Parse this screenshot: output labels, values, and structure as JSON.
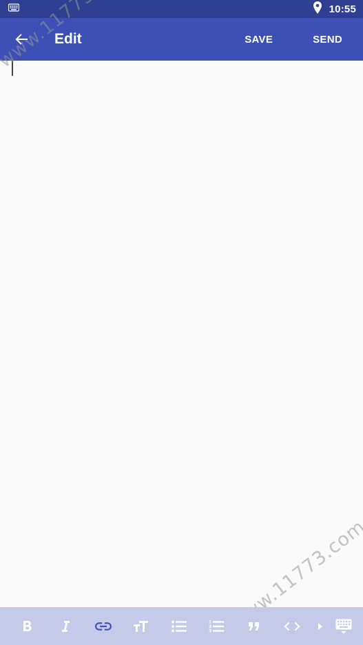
{
  "status_bar": {
    "time": "10:55",
    "icons": [
      "keyboard-icon",
      "location-icon"
    ]
  },
  "app_bar": {
    "title": "Edit",
    "back_icon": "arrow-back-icon",
    "save_label": "SAVE",
    "send_label": "SEND"
  },
  "editor": {
    "content": ""
  },
  "watermark": {
    "text": "www.11773.com"
  },
  "format_bar": {
    "items": [
      "bold-icon",
      "italic-icon",
      "link-icon",
      "text-size-icon",
      "bullet-list-icon",
      "numbered-list-icon",
      "quote-icon",
      "code-icon",
      "more-arrow-icon",
      "keyboard-toggle-icon"
    ]
  },
  "colors": {
    "status_bar": "#2f3f92",
    "app_bar": "#3c50b5",
    "format_bar": "#c5cae9",
    "active_icon": "#3c50b5",
    "icon": "#ffffff"
  }
}
